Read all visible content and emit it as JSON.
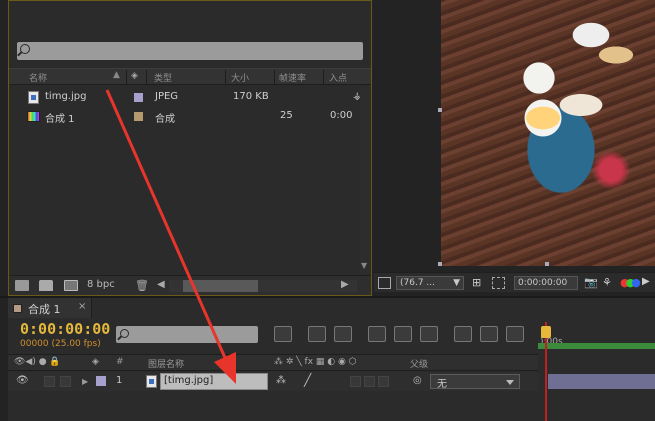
{
  "project": {
    "columns": {
      "name": "名称",
      "type": "类型",
      "size": "大小",
      "fps": "帧速率",
      "in_point": "入点"
    },
    "items": [
      {
        "name": "timg.jpg",
        "type": "JPEG",
        "size": "170 KB",
        "fps": "",
        "in_point": "",
        "label_color": "#a6a0cc"
      },
      {
        "name": "合成 1",
        "type": "合成",
        "size": "",
        "fps": "25",
        "in_point": "0:00",
        "label_color": "#b59a70"
      }
    ],
    "footer": {
      "bit_depth": "8 bpc"
    }
  },
  "viewer": {
    "zoom": "(76.7 ...",
    "timecode": "0:00:00:00"
  },
  "timeline": {
    "tab_label": "合成 1",
    "tab_close": "×",
    "timecode": "0:00:00:00",
    "fps_note": "00000 (25.00 fps)",
    "ruler_start": "):00s",
    "columns": {
      "number": "#",
      "layer_name": "图层名称",
      "parent": "父级"
    },
    "layers": [
      {
        "number": "1",
        "name": "[timg.jpg]",
        "parent": "无"
      }
    ]
  },
  "colors": {
    "accent_timecode": "#e4b83a",
    "playhead": "#c02020",
    "work_area": "#3c8a3c",
    "annotation_arrow": "#e8352c"
  }
}
